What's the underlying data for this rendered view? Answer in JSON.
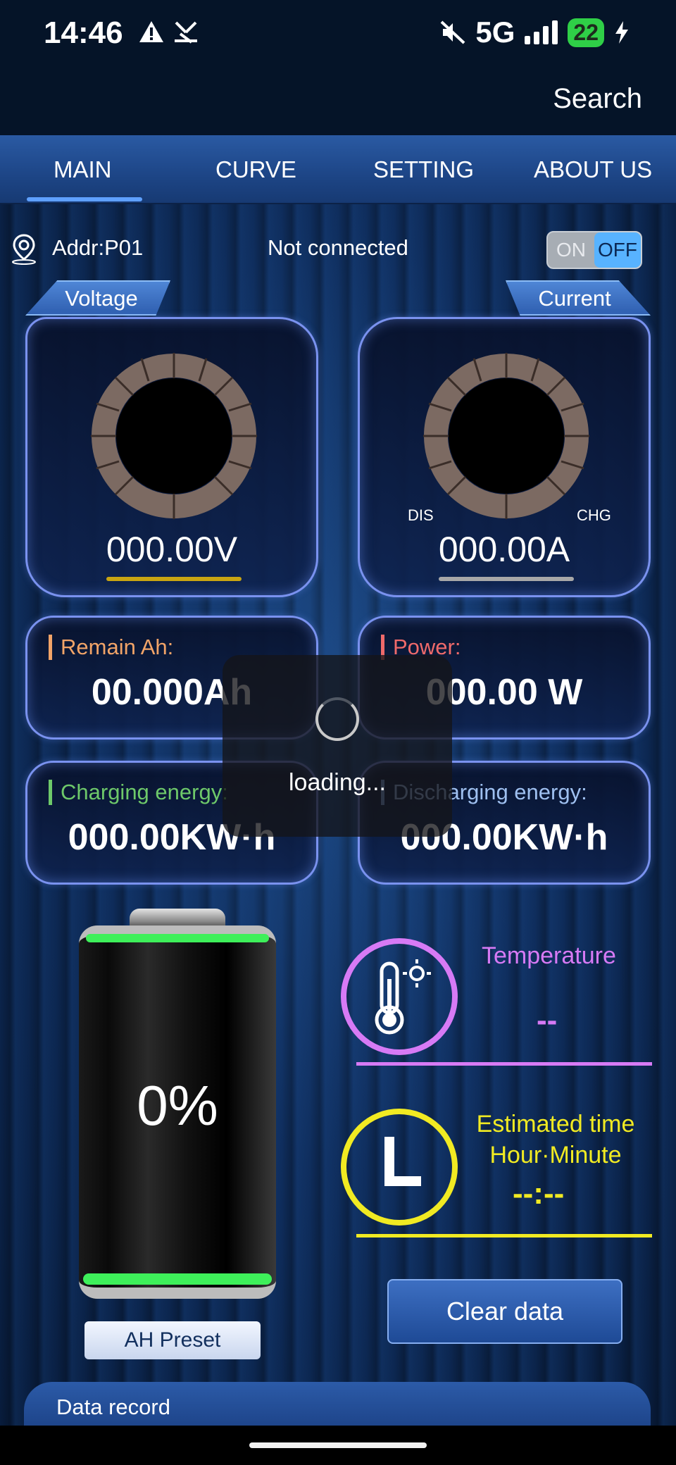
{
  "status_bar": {
    "time": "14:46",
    "left_icons": [
      "warning-icon",
      "location-off-icon"
    ],
    "network": "5G",
    "battery_level": "22",
    "mute_icon": "mute-icon",
    "charging_icon": "bolt-icon"
  },
  "header": {
    "search_label": "Search"
  },
  "tabs": [
    {
      "label": "MAIN",
      "active": true
    },
    {
      "label": "CURVE",
      "active": false
    },
    {
      "label": "SETTING",
      "active": false
    },
    {
      "label": "ABOUT US",
      "active": false
    }
  ],
  "device": {
    "addr": "Addr:P01",
    "connection": "Not connected",
    "toggle_on_label": "ON",
    "toggle_off_label": "OFF"
  },
  "gauges": {
    "voltage": {
      "label": "Voltage",
      "value": "000.00V",
      "color": "#c9a512"
    },
    "current": {
      "label": "Current",
      "value": "000.00A",
      "dis": "DIS",
      "chg": "CHG",
      "color": "#a8a8a8"
    }
  },
  "info": {
    "remain": {
      "label": "Remain Ah:",
      "value": "00.000Ah",
      "color": "#f2a468"
    },
    "power": {
      "label": "Power:",
      "value": "000.00 W",
      "color": "#ef6a6a"
    },
    "charging": {
      "label": "Charging energy:",
      "value": "000.00KW·h",
      "color": "#6ec96a"
    },
    "discharging": {
      "label": "Discharging energy:",
      "value": "000.00KW·h",
      "color": "#7fa8e8"
    }
  },
  "battery": {
    "percent": "0%",
    "preset_label": "AH Preset"
  },
  "temperature": {
    "title": "Temperature",
    "value": "--",
    "color": "#d77af5"
  },
  "estimated_time": {
    "title_line1": "Estimated time",
    "title_line2": "Hour·Minute",
    "value": "--:--",
    "color": "#f1ea22"
  },
  "actions": {
    "clear_label": "Clear data",
    "record_label": "Data record"
  },
  "loading": {
    "text": "loading..."
  }
}
